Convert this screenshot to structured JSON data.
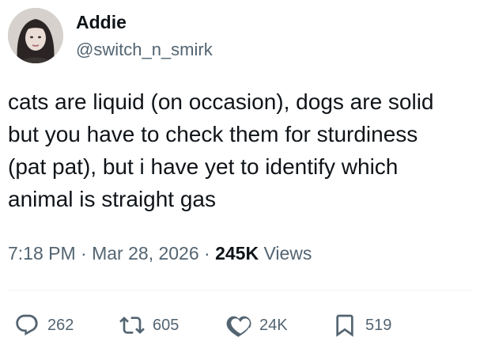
{
  "author": {
    "display_name": "Addie",
    "handle": "@switch_n_smirk",
    "avatar_icon": "user-avatar"
  },
  "tweet": {
    "text": "cats are liquid (on occasion), dogs are solid\nbut you have to check them for sturdiness\n(pat pat), but i have yet to identify which\nanimal is straight gas"
  },
  "meta": {
    "time": "7:18 PM",
    "separator": "·",
    "date": "Mar 28, 2026",
    "views_count": "245K",
    "views_label": "Views"
  },
  "actions": {
    "replies": "262",
    "reposts": "605",
    "likes": "24K",
    "bookmarks": "519"
  },
  "colors": {
    "text_primary": "#0f1419",
    "text_secondary": "#536471",
    "divider": "#eff3f4"
  }
}
